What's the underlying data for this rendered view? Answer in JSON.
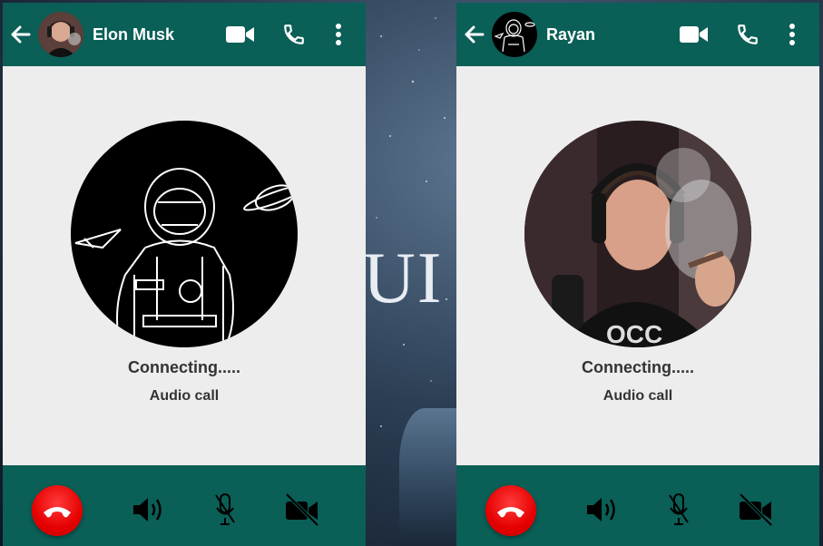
{
  "background": {
    "text": "UI"
  },
  "calls": [
    {
      "contact_name": "Elon Musk",
      "status": "Connecting.....",
      "call_type": "Audio call",
      "avatar_small": "elon-photo",
      "avatar_large": "astronaut-sketch"
    },
    {
      "contact_name": "Rayan",
      "status": "Connecting.....",
      "call_type": "Audio call",
      "avatar_small": "astronaut-sketch",
      "avatar_large": "elon-photo"
    }
  ],
  "icons": {
    "back": "arrow-left-icon",
    "video": "video-camera-icon",
    "call": "phone-icon",
    "more": "more-vertical-icon",
    "end_call": "end-call-icon",
    "speaker": "speaker-icon",
    "mic_off": "mic-off-icon",
    "video_off": "video-off-icon"
  },
  "colors": {
    "header": "#0a5f56",
    "panel": "#ededed",
    "end_call": "#e50000",
    "text": "#333333"
  }
}
